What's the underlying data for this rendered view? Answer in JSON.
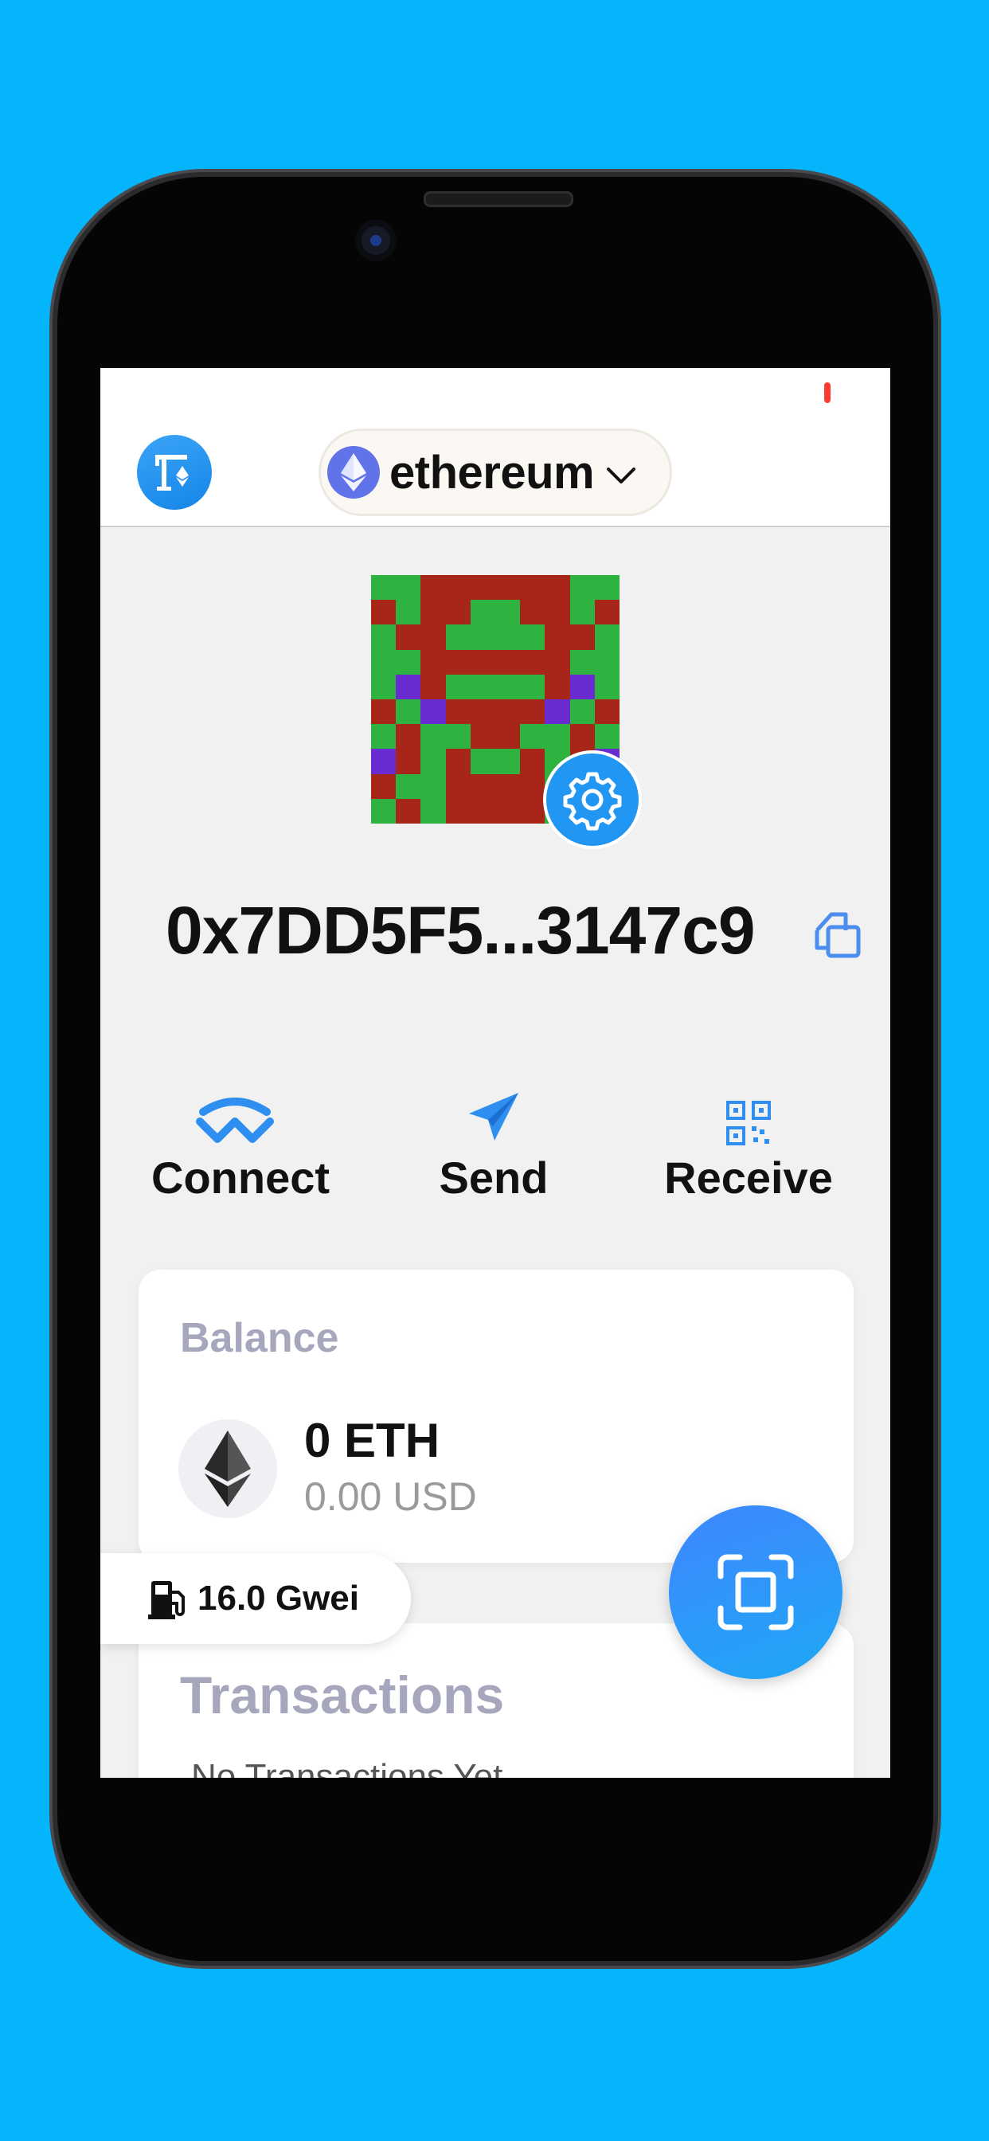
{
  "colors": {
    "background": "#05b5fb",
    "accent": "#2196f3",
    "network_badge": "#6173e8",
    "muted_label": "#a6a6bd"
  },
  "header": {
    "network_name": "ethereum",
    "network_icon": "ethereum-icon"
  },
  "wallet": {
    "address": "0x7DD5F5...3147c9"
  },
  "actions": [
    {
      "label": "Connect",
      "icon": "walletconnect-icon"
    },
    {
      "label": "Send",
      "icon": "paper-plane-icon"
    },
    {
      "label": "Receive",
      "icon": "qr-code-icon"
    }
  ],
  "balance": {
    "label": "Balance",
    "amount": "0 ETH",
    "fiat": "0.00 USD"
  },
  "gas": {
    "value": "16.0 Gwei",
    "icon": "gas-pump-icon"
  },
  "transactions": {
    "title": "Transactions",
    "empty_text": "No Transactions Yet"
  }
}
